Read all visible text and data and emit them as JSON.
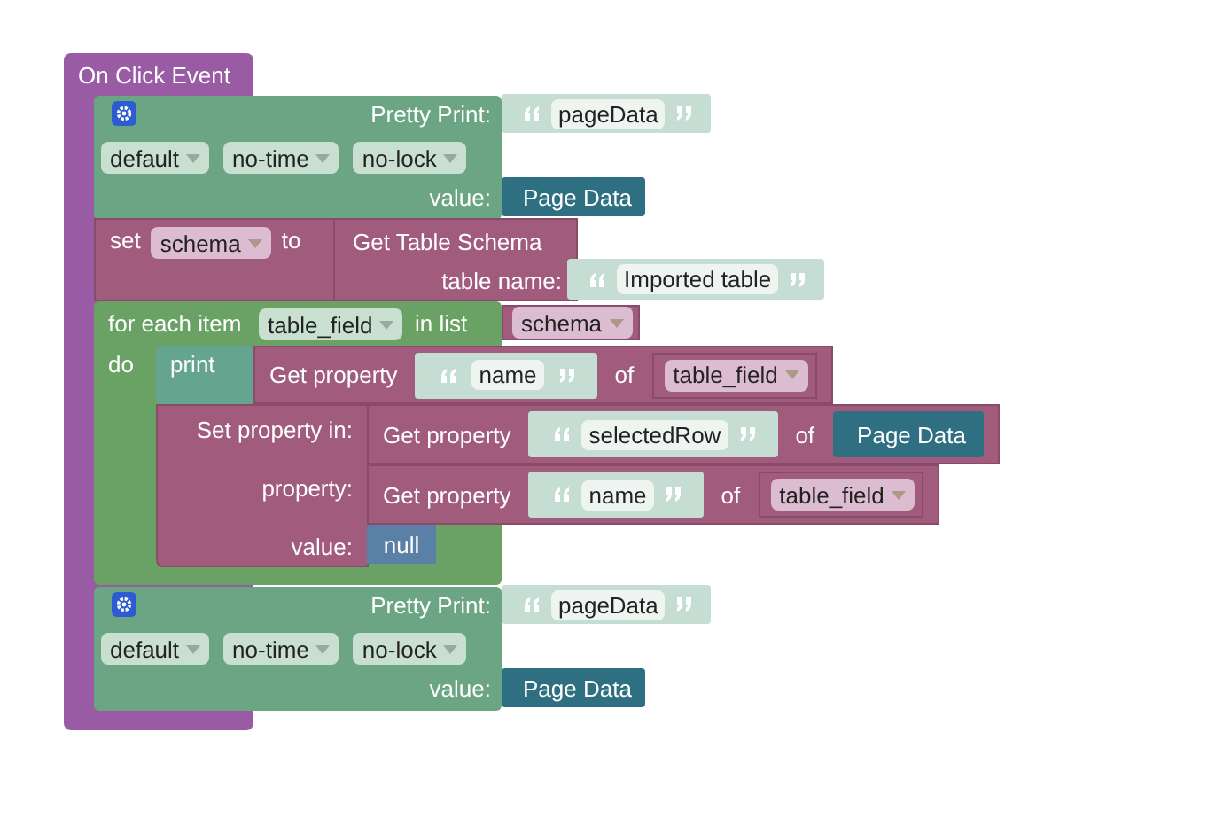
{
  "event": {
    "title": "On Click Event"
  },
  "pretty_prints": [
    {
      "label": "Pretty Print:",
      "text": "pageData",
      "options": [
        "default",
        "no-time",
        "no-lock"
      ],
      "value_label": "value:",
      "value": "Page Data"
    },
    {
      "label": "Pretty Print:",
      "text": "pageData",
      "options": [
        "default",
        "no-time",
        "no-lock"
      ],
      "value_label": "value:",
      "value": "Page Data"
    }
  ],
  "set_variable": {
    "keyword": "set",
    "variable": "schema",
    "connector": "to",
    "call": "Get Table Schema",
    "param_label": "table name:",
    "param_value": "Imported table"
  },
  "for_each": {
    "label": "for each item",
    "variable": "table_field",
    "in_list": "in list",
    "list": "schema",
    "do": "do"
  },
  "print": {
    "label": "print"
  },
  "getters": [
    {
      "label": "Get property",
      "key": "name",
      "of": "of",
      "target": {
        "kind": "variable",
        "text": "table_field"
      }
    },
    {
      "label": "Get property",
      "key": "selectedRow",
      "of": "of",
      "target": {
        "kind": "data",
        "text": "Page Data"
      }
    },
    {
      "label": "Get property",
      "key": "name",
      "of": "of",
      "target": {
        "kind": "variable",
        "text": "table_field"
      }
    }
  ],
  "set_property": {
    "labels": [
      "Set property in:",
      "property:",
      "value:"
    ],
    "value": "null"
  }
}
